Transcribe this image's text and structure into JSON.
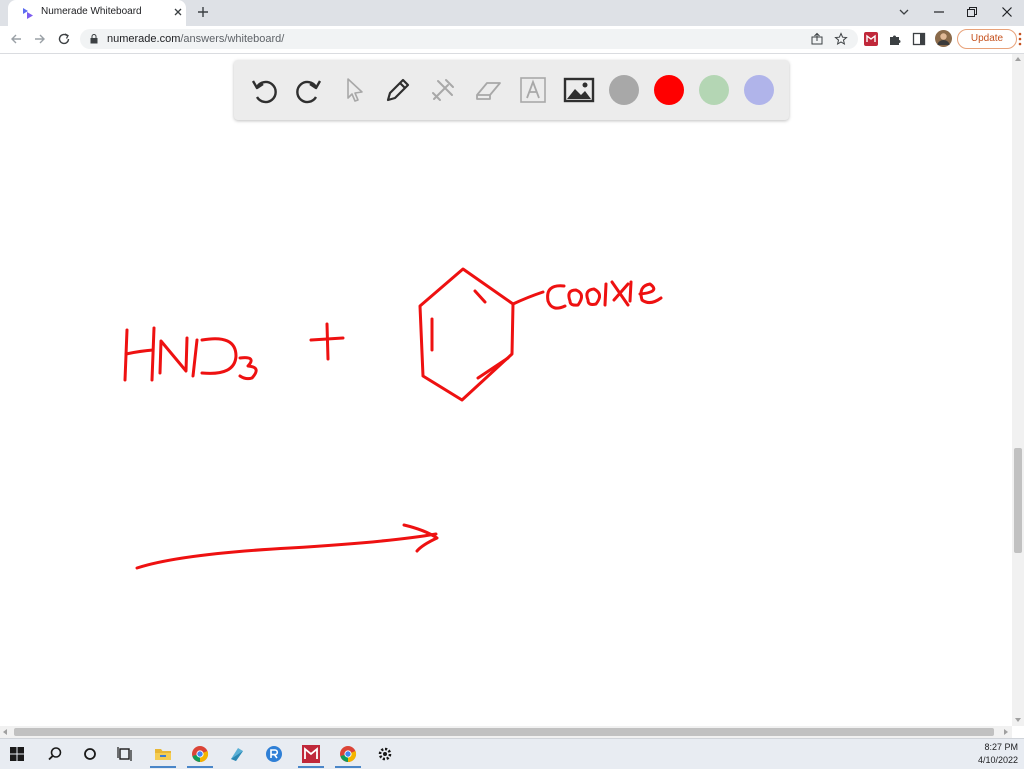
{
  "browser": {
    "tab_title": "Numerade Whiteboard",
    "url_host": "numerade.com",
    "url_path": "/answers/whiteboard/",
    "update_label": "Update"
  },
  "whiteboard": {
    "tools": [
      "undo-icon",
      "redo-icon",
      "pointer-icon",
      "pen-icon",
      "tools-icon",
      "eraser-icon",
      "text-icon",
      "image-icon"
    ],
    "colors": {
      "gray": "#a8a8a8",
      "red": "#ff0000",
      "green": "#b4d6b4",
      "lavender": "#b0b4ea"
    },
    "ink_color": "#ee1111"
  },
  "taskbar": {
    "time": "8:27 PM",
    "date": "4/10/2022"
  }
}
